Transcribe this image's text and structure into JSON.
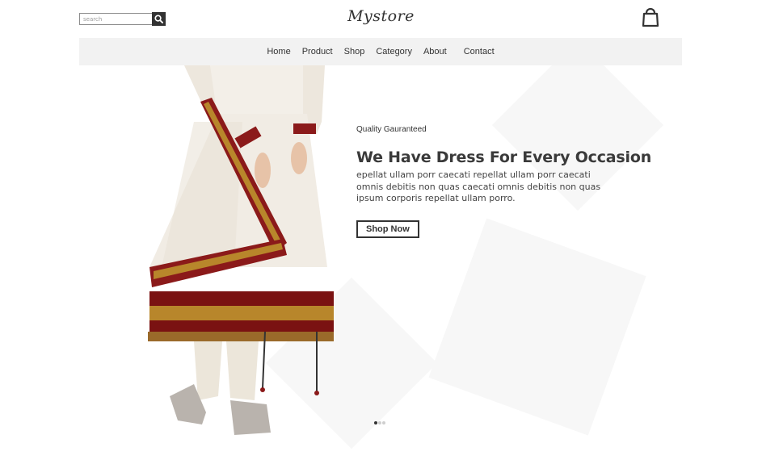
{
  "header": {
    "logo": "Mystore",
    "search": {
      "placeholder": "search",
      "value": ""
    },
    "icons": {
      "search": "search-icon",
      "cart": "shopping-bag-icon"
    }
  },
  "nav": {
    "items": [
      "Home",
      "Product",
      "Shop",
      "Category",
      "About",
      "Contact"
    ]
  },
  "hero": {
    "kicker": "Quality Gauranteed",
    "headline": "We Have Dress For Every Occasion",
    "body": "epellat ullam porr caecati repellat ullam porr caecati omnis debitis non quas caecati omnis debitis non quas ipsum corporis repellat ullam porro.",
    "cta": "Shop Now",
    "image": "model-in-white-anarkali-dress"
  },
  "carousel": {
    "slides": 3,
    "active": 1
  },
  "colors": {
    "accent": "#333333",
    "nav_bg": "#f2f2f2",
    "dress_trim": "#8b1a1a",
    "gold": "#b8862b"
  }
}
